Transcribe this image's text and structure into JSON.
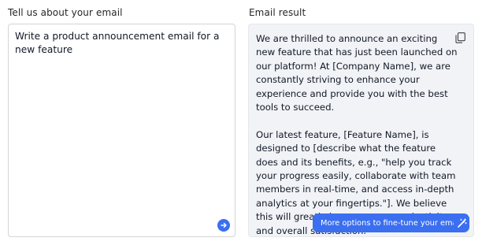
{
  "input_section": {
    "label": "Tell us about your email",
    "prompt_text": "Write a product announcement email for a new feature"
  },
  "result_section": {
    "label": "Email result",
    "paragraphs": [
      "We are thrilled to announce an exciting new feature that has just been launched on our platform! At [Company Name], we are constantly striving to enhance your experience and provide you with the best tools to succeed.",
      "Our latest feature, [Feature Name], is designed to [describe what the feature does and its benefits, e.g., \"help you track your progress easily, collaborate with team members in real-time, and access in-depth analytics at your fingertips.\"]. We believe this will greatly improve your productivity and overall satisfaction."
    ]
  },
  "actions": {
    "finetune_label": "More options to fine-tune your email"
  },
  "icons": {
    "send": "arrow-right-icon",
    "copy": "copy-icon",
    "wand": "magic-wand-icon"
  },
  "colors": {
    "accent": "#3b6ff0",
    "result_bg": "#f1f3f6"
  }
}
